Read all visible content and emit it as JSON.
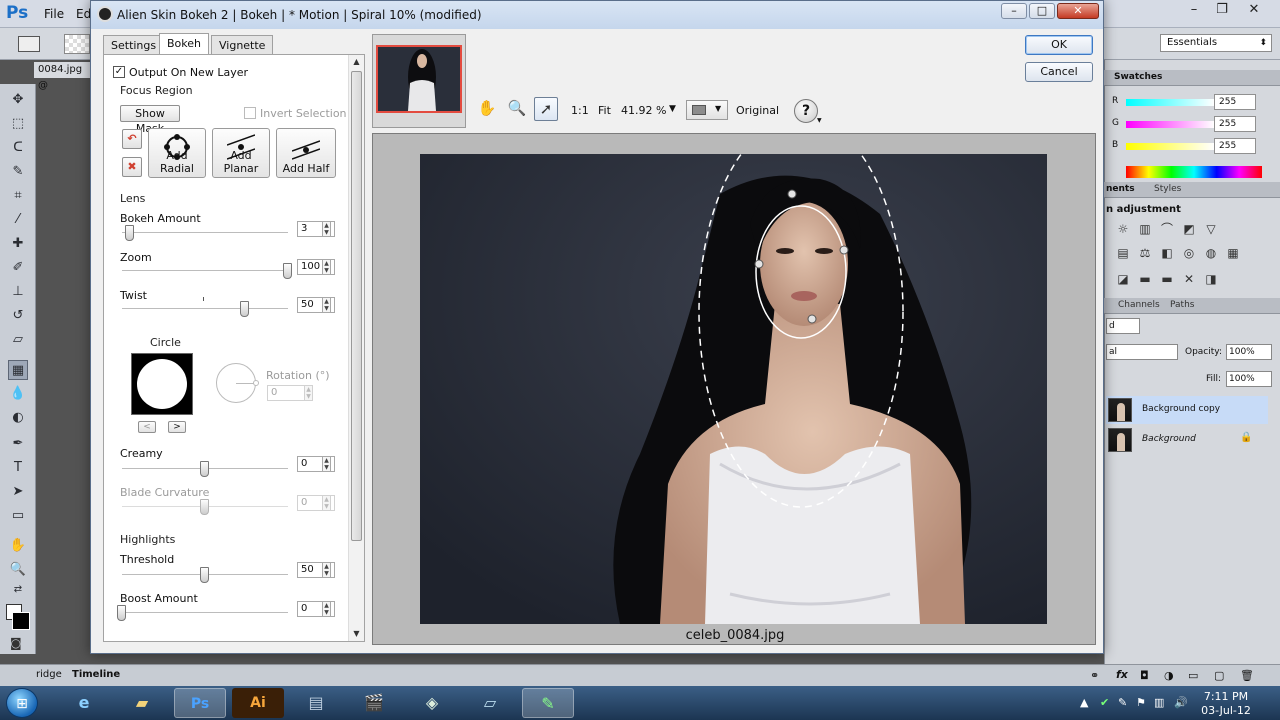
{
  "photoshop": {
    "logo": "Ps",
    "menu": [
      "File",
      "Ed"
    ],
    "doc_tab": "0084.jpg @",
    "workspace": "Essentials",
    "swatches_tab": "Swatches",
    "color": {
      "r_label": "R",
      "g_label": "G",
      "b_label": "B",
      "r": "255",
      "g": "255",
      "b": "255"
    },
    "adjustments_tab": "nents",
    "styles_tab": "Styles",
    "adjustments_title": "n adjustment",
    "channels_tab": "Channels",
    "paths_tab": "Paths",
    "layer_mode": "d",
    "layer_mode2": "al",
    "opacity_label": "Opacity:",
    "opacity": "100%",
    "fill_label": "Fill:",
    "fill": "100%",
    "layers": [
      {
        "name": "Background copy",
        "selected": true
      },
      {
        "name": "Background",
        "locked": true
      }
    ],
    "bottom_tabs": [
      "ridge",
      "Timeline"
    ]
  },
  "taskbar": {
    "apps": [
      "IE",
      "Folder",
      "Ps",
      "Ai",
      "App",
      "Video",
      "Tool",
      "Files",
      "Pen"
    ],
    "time": "7:11 PM",
    "date": "03-Jul-12"
  },
  "dialog": {
    "title": "Alien Skin Bokeh 2 | Bokeh | * Motion | Spiral  10% (modified)",
    "tabs": [
      "Settings",
      "Bokeh",
      "Vignette"
    ],
    "active_tab": "Bokeh",
    "ok": "OK",
    "cancel": "Cancel",
    "output_on_new_layer": {
      "label": "Output On New Layer",
      "checked": true
    },
    "focus_region": {
      "title": "Focus Region",
      "show_mask": "Show Mask",
      "invert_selection": "Invert Selection",
      "add_radial": "Add Radial",
      "add_planar": "Add Planar",
      "add_half": "Add Half"
    },
    "lens": {
      "title": "Lens",
      "bokeh_amount": {
        "label": "Bokeh Amount",
        "value": 3,
        "fraction": 0.05
      },
      "zoom": {
        "label": "Zoom",
        "value": 100,
        "fraction": 1.0
      },
      "twist": {
        "label": "Twist",
        "value": 50,
        "fraction": 0.74
      }
    },
    "shape": {
      "title": "Circle",
      "rotation_label": "Rotation (°)",
      "rotation": "0",
      "prev": "<",
      "next": ">"
    },
    "creamy": {
      "label": "Creamy",
      "value": 0,
      "fraction": 0.5
    },
    "blade_curvature": {
      "label": "Blade Curvature",
      "value": 0,
      "fraction": 0.5
    },
    "highlights": {
      "title": "Highlights",
      "threshold": {
        "label": "Threshold",
        "value": 50,
        "fraction": 0.5
      },
      "boost_amount": {
        "label": "Boost Amount",
        "value": 0,
        "fraction": 0.0
      }
    },
    "view": {
      "one_to_one": "1:1",
      "fit": "Fit",
      "zoom": "41.92 %",
      "original": "Original",
      "help": "?"
    },
    "filename": "celeb_0084.jpg"
  }
}
